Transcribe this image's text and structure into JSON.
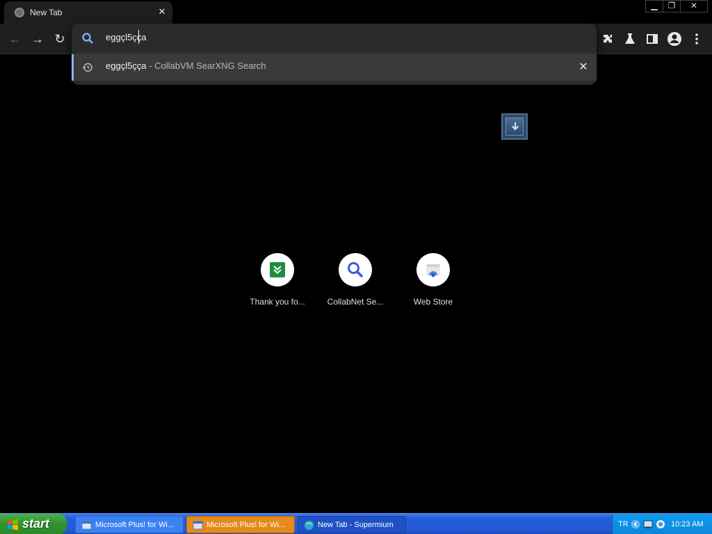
{
  "browser": {
    "tab": {
      "title": "New Tab",
      "close": "✕"
    },
    "window_controls": {
      "minimize": "▁",
      "maximize": "❐",
      "close": "✕"
    },
    "nav": {
      "back": "←",
      "forward": "→",
      "reload": "↻"
    },
    "omnibox": {
      "text": "eggçl5çça",
      "suggestion": {
        "query": "eggçl5çça",
        "source": " - CollabVM SearXNG Search",
        "remove": "✕"
      }
    },
    "toolbar_icons": [
      "extensions-icon",
      "labs-icon",
      "side-panel-icon",
      "profile-icon",
      "menu-icon"
    ]
  },
  "shortcuts": [
    {
      "label": "Thank you fo...",
      "icon": "download-green-icon"
    },
    {
      "label": "CollabNet Se...",
      "icon": "search-blue-icon"
    },
    {
      "label": "Web Store",
      "icon": "webstore-icon"
    }
  ],
  "taskbar": {
    "start_label": "start",
    "tasks": [
      {
        "label": "Microsoft Plus! for Wi..."
      },
      {
        "label": "Microsoft Plus! for Wi..."
      },
      {
        "label": "New Tab - Supermium"
      }
    ],
    "tray": {
      "lang": "TR",
      "clock": "10:23 AM"
    }
  },
  "colors": {
    "accent": "#8ab4f8",
    "taskbar": "#245edb",
    "start": "#3a9a3a"
  }
}
